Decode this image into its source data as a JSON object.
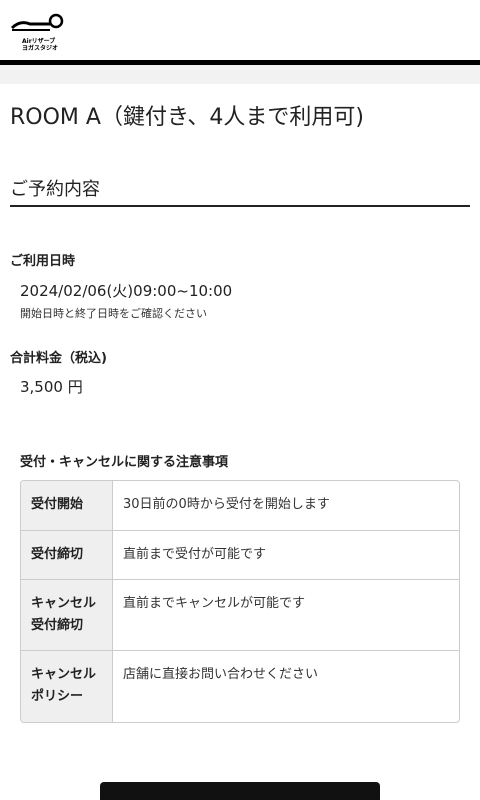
{
  "header": {
    "logo_line1": "Airリザーブ",
    "logo_line2": "ヨガスタジオ"
  },
  "room": {
    "title": "ROOM A（鍵付き、4人まで利用可)"
  },
  "reservation": {
    "section_title": "ご予約内容",
    "date_label": "ご利用日時",
    "date_value": "2024/02/06(火)09:00~10:00",
    "date_note": "開始日時と終了日時をご確認ください",
    "price_label": "合計料金（税込)",
    "price_value": "3,500 円"
  },
  "notice": {
    "title": "受付・キャンセルに関する注意事項",
    "rows": [
      {
        "label": "受付開始",
        "text": "30日前の0時から受付を開始します"
      },
      {
        "label": "受付締切",
        "text": "直前まで受付が可能です"
      },
      {
        "label": "キャンセル受付締切",
        "text": "直前までキャンセルが可能です"
      },
      {
        "label": "キャンセルポリシー",
        "text": "店舗に直接お問い合わせください"
      }
    ]
  },
  "colors": {
    "primary_button": "#111111",
    "table_header_bg": "#efefef",
    "page_bg": "#f2f2f2"
  }
}
